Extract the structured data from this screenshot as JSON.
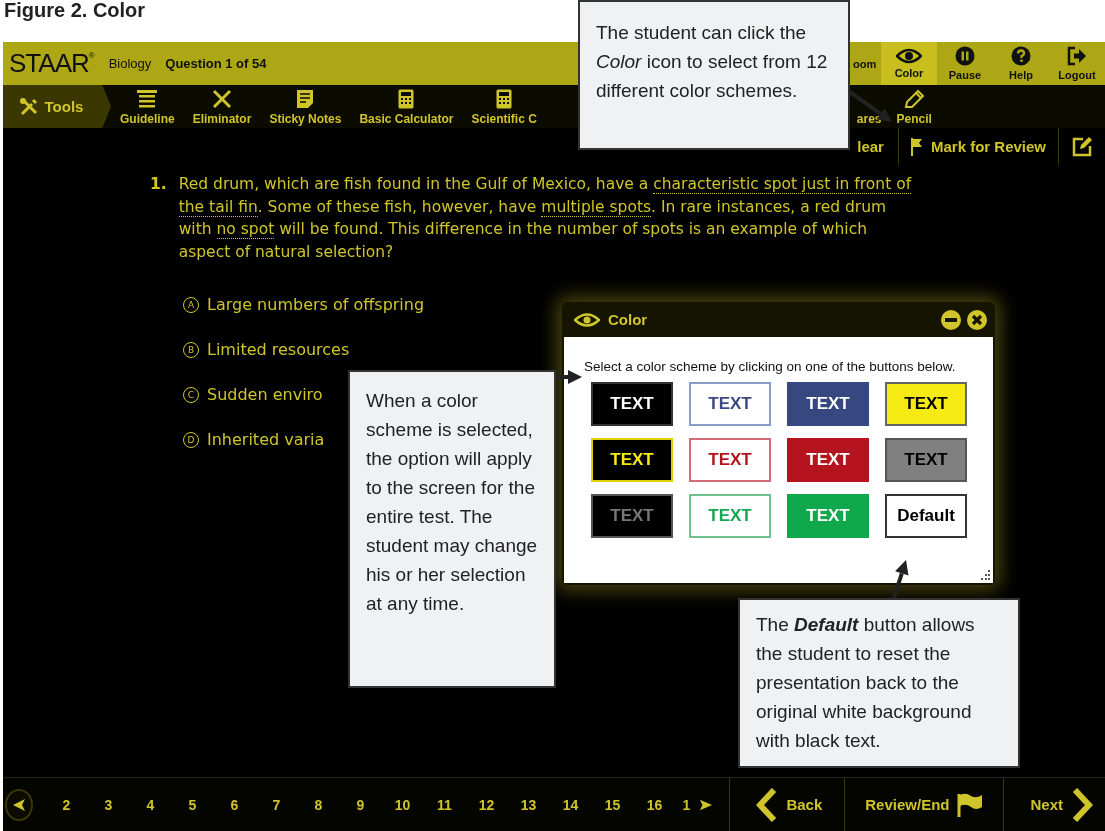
{
  "figure_title": "Figure 2. Color",
  "header": {
    "logo": "STAAR",
    "logo_mark": "®",
    "subject": "Biology",
    "question_counter": "Question 1 of 54",
    "actions": [
      {
        "kind": "zoom",
        "label": "oom",
        "selected": false
      },
      {
        "kind": "color",
        "label": "Color",
        "selected": true
      },
      {
        "kind": "pause",
        "label": "Pause",
        "selected": false
      },
      {
        "kind": "help",
        "label": "Help",
        "selected": false
      },
      {
        "kind": "logout",
        "label": "Logout",
        "selected": false
      }
    ]
  },
  "toolbar": {
    "tools_label": "Tools",
    "items": [
      {
        "kind": "guideline",
        "label": "Guideline"
      },
      {
        "kind": "eliminator",
        "label": "Eliminator"
      },
      {
        "kind": "sticky",
        "label": "Sticky Notes"
      },
      {
        "kind": "calculator",
        "label": "Basic Calculator"
      },
      {
        "kind": "calculator",
        "label": "Scientific C"
      },
      {
        "kind": "partial",
        "label": "ares"
      },
      {
        "kind": "pencil",
        "label": "Pencil"
      }
    ]
  },
  "question_tools": [
    {
      "kind": "clear",
      "label": "lear"
    },
    {
      "kind": "flag",
      "label": "Mark for Review"
    },
    {
      "kind": "edit"
    }
  ],
  "question": {
    "number": "1.",
    "segments": [
      {
        "text": "Red drum, which are fish found in the Gulf of Mexico, have a ",
        "underlined": false
      },
      {
        "text": "characteristic spot just in front of the tail fin",
        "underlined": true
      },
      {
        "text": ". Some of these fish, however, have ",
        "underlined": false
      },
      {
        "text": "multiple spots",
        "underlined": true
      },
      {
        "text": ". In rare instances, a red drum with ",
        "underlined": false
      },
      {
        "text": "no spot",
        "underlined": true
      },
      {
        "text": " will be found. This difference in the number of spots is an example of which aspect of natural selection?",
        "underlined": false
      }
    ]
  },
  "options": [
    {
      "letter": "A",
      "text": "Large numbers of offspring"
    },
    {
      "letter": "B",
      "text": "Limited resources"
    },
    {
      "letter": "C",
      "text": "Sudden enviro"
    },
    {
      "letter": "D",
      "text": "Inherited varia"
    }
  ],
  "color_dialog": {
    "title": "Color",
    "instruction": "Select a color scheme by clicking on one of the buttons below.",
    "schemes": [
      {
        "label": "TEXT",
        "color": "#000000",
        "text": {
          "color": "#ffffff"
        },
        "border": {
          "color": "#333333"
        }
      },
      {
        "label": "TEXT",
        "color": "#ffffff",
        "text": {
          "color": "#3b4a82"
        },
        "border": {
          "color": "#8a9cc4"
        }
      },
      {
        "label": "TEXT",
        "color": "#37477f",
        "text": {
          "color": "#ffffff"
        },
        "border": {
          "color": "#37477f"
        }
      },
      {
        "label": "TEXT",
        "color": "#f5ea14",
        "text": {
          "color": "#000000"
        },
        "border": {
          "color": "#666666"
        }
      },
      {
        "label": "TEXT",
        "color": "#000000",
        "text": {
          "color": "#f5ea14"
        },
        "border": {
          "color": "#e0d000"
        }
      },
      {
        "label": "TEXT",
        "color": "#ffffff",
        "text": {
          "color": "#b5141f"
        },
        "border": {
          "color": "#d46a78"
        }
      },
      {
        "label": "TEXT",
        "color": "#b5141f",
        "text": {
          "color": "#ffffff"
        },
        "border": {
          "color": "#b5141f"
        }
      },
      {
        "label": "TEXT",
        "color": "#808080",
        "text": {
          "color": "#000000"
        },
        "border": {
          "color": "#555555"
        }
      },
      {
        "label": "TEXT",
        "color": "#000000",
        "text": {
          "color": "#777777"
        },
        "border": {
          "color": "#555555"
        }
      },
      {
        "label": "TEXT",
        "color": "#ffffff",
        "text": {
          "color": "#14a850"
        },
        "border": {
          "color": "#70c090"
        }
      },
      {
        "label": "TEXT",
        "color": "#10a84c",
        "text": {
          "color": "#ffffff"
        },
        "border": {
          "color": "#10a84c"
        }
      },
      {
        "label": "Default",
        "color": "#ffffff",
        "text": {
          "color": "#000000"
        },
        "border": {
          "color": "#333333"
        }
      }
    ]
  },
  "nav": {
    "pages": [
      "2",
      "3",
      "4",
      "5",
      "6",
      "7",
      "8",
      "9",
      "10",
      "11",
      "12",
      "13",
      "14",
      "15",
      "16",
      "1"
    ],
    "back": "Back",
    "review": "Review/End",
    "next": "Next"
  },
  "callouts": [
    {
      "text": "The student can click the *Color* icon to select from 12 different color schemes."
    },
    {
      "text": "When a color scheme is selected, the option will apply to the screen for the entire test. The student may change his or her selection at any time."
    },
    {
      "text": "The **Default** button allows the student to reset the presentation back to the original white background with black text."
    }
  ]
}
